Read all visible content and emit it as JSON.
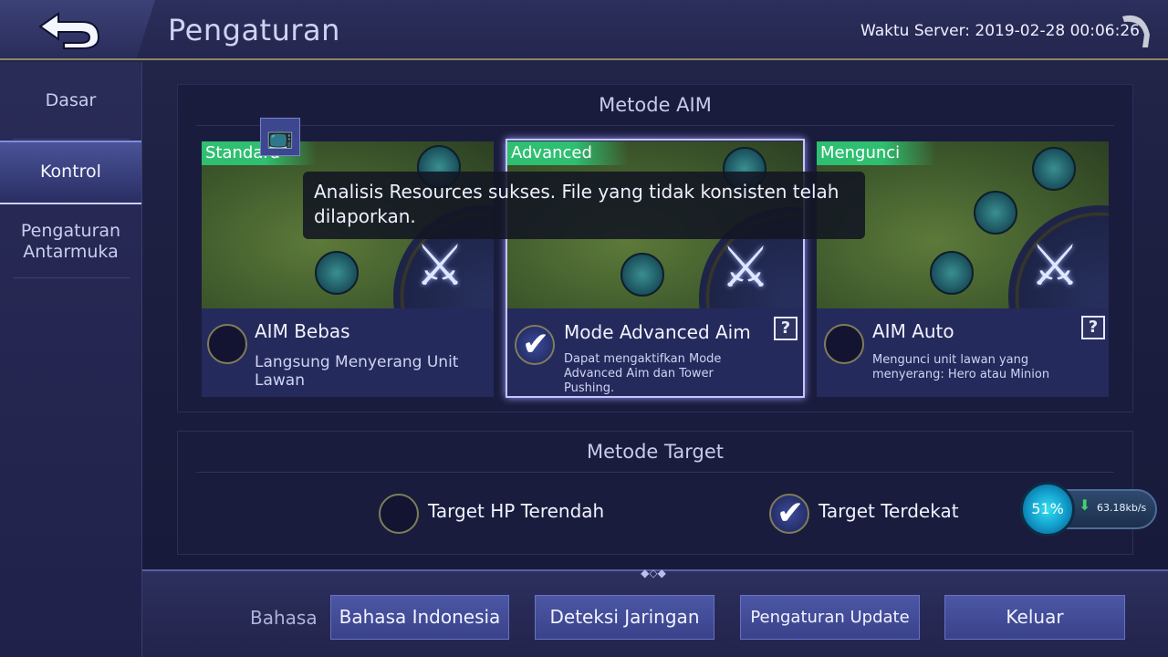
{
  "header": {
    "title": "Pengaturan",
    "server_time": "Waktu Server: 2019-02-28 00:06:26"
  },
  "sidebar": {
    "items": [
      {
        "label": "Dasar"
      },
      {
        "label": "Kontrol",
        "active": true
      },
      {
        "label": "Pengaturan Antarmuka"
      }
    ]
  },
  "aim": {
    "title": "Metode AIM",
    "cards": [
      {
        "tag": "Standard",
        "label": "AIM Bebas",
        "desc": "Langsung Menyerang Unit Lawan",
        "checked": false
      },
      {
        "tag": "Advanced",
        "label": "Mode Advanced Aim",
        "desc": "Dapat mengaktifkan Mode Advanced Aim dan Tower Pushing.",
        "checked": true
      },
      {
        "tag": "Mengunci",
        "label": "AIM Auto",
        "desc": "Mengunci unit lawan yang menyerang: Hero atau Minion",
        "checked": false
      }
    ],
    "help_symbol": "?"
  },
  "toast": {
    "message": "Analisis Resources sukses. File yang tidak konsisten telah dilaporkan."
  },
  "target": {
    "title": "Metode Target",
    "options": [
      {
        "label": "Target HP Terendah",
        "checked": false
      },
      {
        "label": "Target Terdekat",
        "checked": true
      }
    ]
  },
  "download": {
    "percent_label": "51%",
    "progress": 0.51,
    "speed": "63.18kb/s"
  },
  "bottom": {
    "language_label": "Bahasa",
    "language_value": "Bahasa Indonesia",
    "network_button": "Deteksi Jaringan",
    "update_button": "Pengaturan Update",
    "exit_button": "Keluar"
  },
  "colors": {
    "accent_green": "#2fbf71",
    "button_blue": "#4c57a5",
    "panel_bg": "#1a1c3d"
  },
  "icons": {
    "back": "back-arrow-icon",
    "tv": "tv-icon",
    "help": "help-icon",
    "check": "check-icon",
    "download": "download-arrow-icon"
  }
}
